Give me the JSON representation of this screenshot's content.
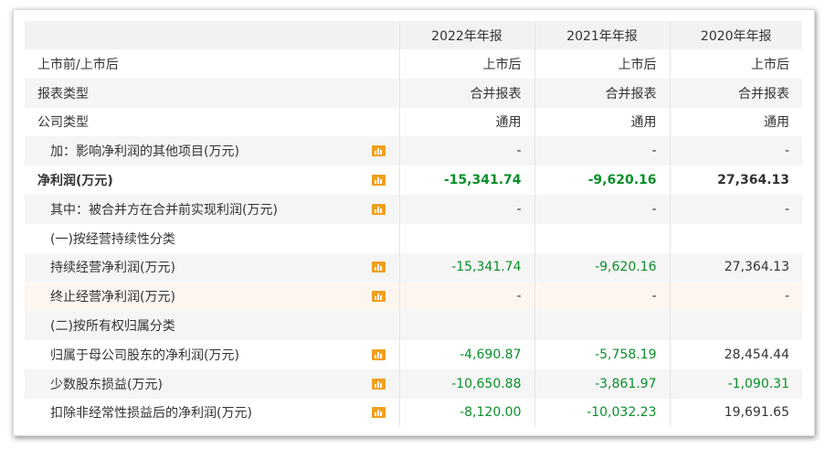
{
  "headers": [
    "",
    "",
    "2022年年报",
    "2021年年报",
    "2020年年报"
  ],
  "rows": [
    {
      "label": "上市前/上市后",
      "indent": false,
      "bold": false,
      "icon": false,
      "values": [
        "上市后",
        "上市后",
        "上市后"
      ],
      "colors": [
        "pos",
        "pos",
        "pos"
      ]
    },
    {
      "label": "报表类型",
      "indent": false,
      "bold": false,
      "icon": false,
      "values": [
        "合并报表",
        "合并报表",
        "合并报表"
      ],
      "colors": [
        "pos",
        "pos",
        "pos"
      ]
    },
    {
      "label": "公司类型",
      "indent": false,
      "bold": false,
      "icon": false,
      "values": [
        "通用",
        "通用",
        "通用"
      ],
      "colors": [
        "pos",
        "pos",
        "pos"
      ]
    },
    {
      "label": "加：影响净利润的其他项目(万元)",
      "indent": true,
      "bold": false,
      "icon": true,
      "values": [
        "-",
        "-",
        "-"
      ],
      "colors": [
        "pos",
        "pos",
        "pos"
      ]
    },
    {
      "label": "净利润(万元)",
      "indent": false,
      "bold": true,
      "icon": true,
      "values": [
        "-15,341.74",
        "-9,620.16",
        "27,364.13"
      ],
      "colors": [
        "neg",
        "neg",
        "pos"
      ]
    },
    {
      "label": "其中：被合并方在合并前实现利润(万元)",
      "indent": true,
      "bold": false,
      "icon": true,
      "values": [
        "-",
        "-",
        "-"
      ],
      "colors": [
        "pos",
        "pos",
        "pos"
      ]
    },
    {
      "label": "(一)按经营持续性分类",
      "indent": true,
      "bold": false,
      "icon": false,
      "values": [
        "",
        "",
        ""
      ],
      "colors": [
        "pos",
        "pos",
        "pos"
      ]
    },
    {
      "label": "持续经营净利润(万元)",
      "indent": true,
      "bold": false,
      "icon": true,
      "values": [
        "-15,341.74",
        "-9,620.16",
        "27,364.13"
      ],
      "colors": [
        "neg",
        "neg",
        "pos"
      ]
    },
    {
      "label": "终止经营净利润(万元)",
      "indent": true,
      "bold": false,
      "icon": true,
      "values": [
        "-",
        "-",
        "-"
      ],
      "colors": [
        "pos",
        "pos",
        "pos"
      ]
    },
    {
      "label": "(二)按所有权归属分类",
      "indent": true,
      "bold": false,
      "icon": false,
      "values": [
        "",
        "",
        ""
      ],
      "colors": [
        "pos",
        "pos",
        "pos"
      ]
    },
    {
      "label": "归属于母公司股东的净利润(万元)",
      "indent": true,
      "bold": false,
      "icon": true,
      "values": [
        "-4,690.87",
        "-5,758.19",
        "28,454.44"
      ],
      "colors": [
        "neg",
        "neg",
        "pos"
      ]
    },
    {
      "label": "少数股东损益(万元)",
      "indent": true,
      "bold": false,
      "icon": true,
      "values": [
        "-10,650.88",
        "-3,861.97",
        "-1,090.31"
      ],
      "colors": [
        "neg",
        "neg",
        "neg"
      ]
    },
    {
      "label": "扣除非经常性损益后的净利润(万元)",
      "indent": true,
      "bold": false,
      "icon": true,
      "values": [
        "-8,120.00",
        "-10,032.23",
        "19,691.65"
      ],
      "colors": [
        "neg",
        "neg",
        "pos"
      ]
    }
  ],
  "icon_name": "bar-chart-icon",
  "colors": {
    "negative": "#0b8f2a",
    "positive": "#333333",
    "header_bg": "#f2f2f2",
    "zebra_bg": "#f5f5f5",
    "highlight_bg": "#fdf6f0",
    "icon": "#f0a020"
  }
}
